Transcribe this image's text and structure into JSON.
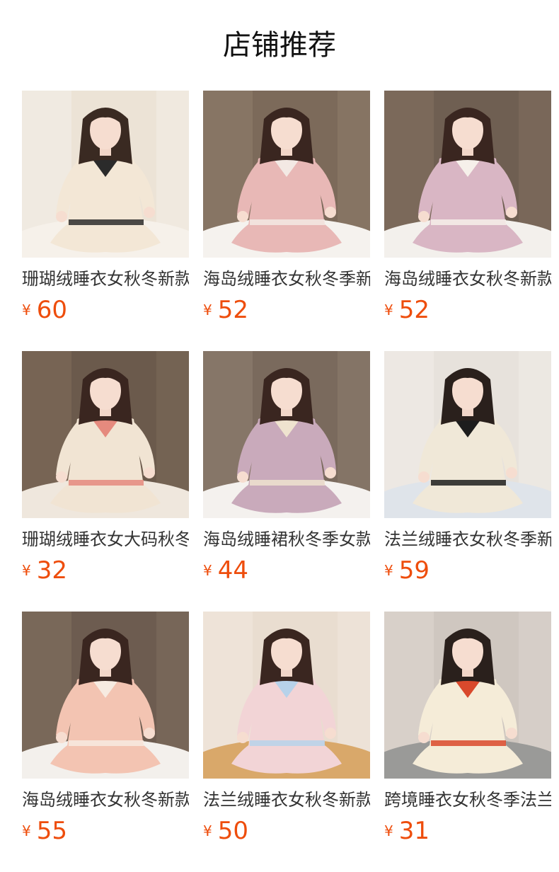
{
  "header": {
    "title": "店铺推荐"
  },
  "currency_symbol": "¥",
  "products": [
    {
      "name": "珊瑚绒睡衣女秋冬新款",
      "price": "60",
      "bg": "#ece3d6",
      "wall": "#f4efe8",
      "outfit": "#f3e7d6",
      "trim": "#2b2b2b",
      "hair": "#3a2a22",
      "floor": "#f6f1ea"
    },
    {
      "name": "海岛绒睡衣女秋冬季新款",
      "price": "52",
      "bg": "#7c6a5a",
      "wall": "#8f7d6b",
      "outfit": "#e8b8b6",
      "trim": "#f3e9e4",
      "hair": "#3a2620",
      "floor": "#f5f2ee"
    },
    {
      "name": "海岛绒睡衣女秋冬新款",
      "price": "52",
      "bg": "#6f5f52",
      "wall": "#837060",
      "outfit": "#d9b6c4",
      "trim": "#f6f0ea",
      "hair": "#3a2620",
      "floor": "#f3f0ec"
    },
    {
      "name": "珊瑚绒睡衣女大码秋冬",
      "price": "32",
      "bg": "#6b5a4c",
      "wall": "#7e6b5a",
      "outfit": "#f1e4d3",
      "trim": "#e58a7e",
      "hair": "#3a2620",
      "floor": "#efe7dd"
    },
    {
      "name": "海岛绒睡裙秋冬季女款",
      "price": "44",
      "bg": "#7a6a5d",
      "wall": "#8e7e70",
      "outfit": "#c9aabb",
      "trim": "#efe3cf",
      "hair": "#3a2620",
      "floor": "#f4f1ee"
    },
    {
      "name": "法兰绒睡衣女秋冬季新款",
      "price": "59",
      "bg": "#e7e2dc",
      "wall": "#f1ede8",
      "outfit": "#f0e8d8",
      "trim": "#1d1d1d",
      "hair": "#2a201c",
      "floor": "#dfe4ea"
    },
    {
      "name": "海岛绒睡衣女秋冬新款",
      "price": "55",
      "bg": "#6d5c50",
      "wall": "#82705f",
      "outfit": "#f3c4b2",
      "trim": "#f7ebe1",
      "hair": "#3a2620",
      "floor": "#f3f0ec"
    },
    {
      "name": "法兰绒睡衣女秋冬新款",
      "price": "50",
      "bg": "#e9ddd0",
      "wall": "#f2e8dd",
      "outfit": "#f2d4d6",
      "trim": "#b7d2ea",
      "hair": "#3a2620",
      "floor": "#d9a86a"
    },
    {
      "name": "跨境睡衣女秋冬季法兰绒",
      "price": "31",
      "bg": "#cfc7c0",
      "wall": "#ddd6cf",
      "outfit": "#f5ecd8",
      "trim": "#d9492c",
      "hair": "#2a201c",
      "floor": "#9a9a98"
    }
  ]
}
